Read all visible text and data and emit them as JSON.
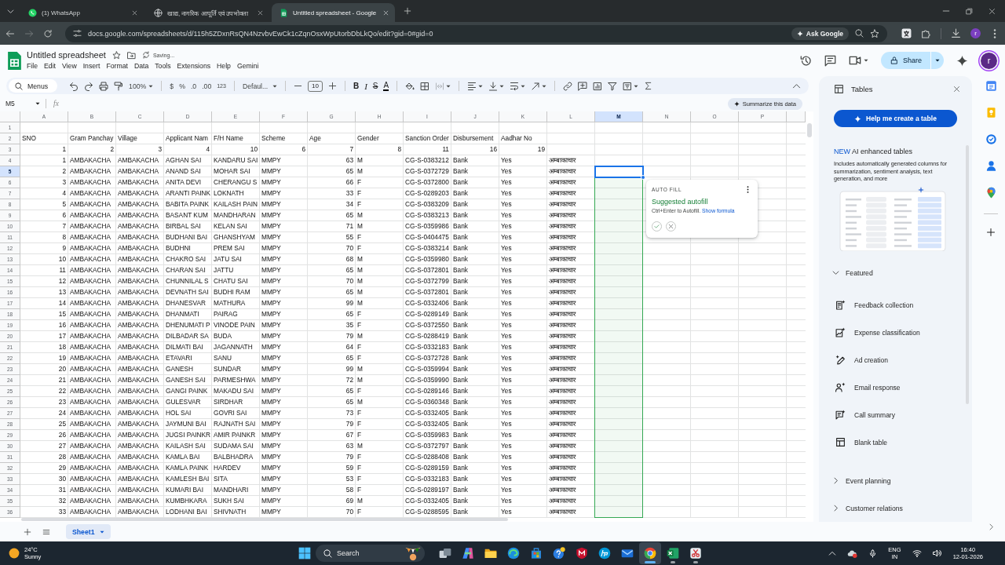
{
  "browser": {
    "tabs": [
      {
        "title": "(1) WhatsApp",
        "selected": false
      },
      {
        "title": "खाद्य, नागरिक आपूर्ति एवं उपभोक्ता",
        "selected": false
      },
      {
        "title": "Untitled spreadsheet - Google",
        "selected": true
      }
    ],
    "forward_button": {
      "disabled": true
    },
    "url": "docs.google.com/spreadsheets/d/115h5ZDxnRsQN4NzvbvEwCk1cZqnOsxWpUtorbDbLkQo/edit?gid=0#gid=0",
    "ask_button": "Ask Google",
    "profile_initial": "r"
  },
  "document": {
    "title": "Untitled spreadsheet",
    "save_status": "Saving...",
    "menu": [
      "File",
      "Edit",
      "View",
      "Insert",
      "Format",
      "Data",
      "Tools",
      "Extensions",
      "Help",
      "Gemini"
    ],
    "share_button": "Share",
    "account_initial": "r"
  },
  "toolbar": {
    "search": "Menus",
    "zoom": "100%",
    "currency": "$",
    "percent": "%",
    "decrease_decimal": ".0",
    "increase_decimal": ".00",
    "number_format": "123",
    "font": "Defaul...",
    "font_size": "10",
    "bold": "B",
    "italic": "I",
    "strikethrough": "S",
    "text_color": "A",
    "merge_button": {
      "disabled": true
    }
  },
  "formula_bar": {
    "cell_reference": "M5",
    "function_label": "fx"
  },
  "summarize_button": "Summarize this data",
  "sheet": {
    "columns": [
      {
        "label": "A",
        "selected": false
      },
      {
        "label": "B",
        "selected": false
      },
      {
        "label": "C",
        "selected": false
      },
      {
        "label": "D",
        "selected": false
      },
      {
        "label": "E",
        "selected": false
      },
      {
        "label": "F",
        "selected": false
      },
      {
        "label": "G",
        "selected": false
      },
      {
        "label": "H",
        "selected": false
      },
      {
        "label": "I",
        "selected": false
      },
      {
        "label": "J",
        "selected": false
      },
      {
        "label": "K",
        "selected": false
      },
      {
        "label": "L",
        "selected": false
      },
      {
        "label": "M",
        "selected": true
      },
      {
        "label": "N",
        "selected": false
      },
      {
        "label": "O",
        "selected": false
      },
      {
        "label": "P",
        "selected": false
      }
    ],
    "rows": [
      {
        "number": "1",
        "selected": false
      },
      {
        "number": "2",
        "selected": false,
        "cells": [
          "SNO",
          "Gram Panchay",
          "Village",
          "Applicant Nam",
          "F/H Name",
          "Scheme",
          "Age",
          "Gender",
          "Sanction Order",
          "Disbursement",
          "Aadhar No"
        ]
      },
      {
        "number": "3",
        "selected": false,
        "cells": [
          "1",
          "2",
          "3",
          "4",
          "10",
          "6",
          "7",
          "8",
          "11",
          "16",
          "19"
        ]
      },
      {
        "number": "4",
        "selected": false,
        "cells": [
          "1",
          "AMBAKACHA",
          "AMBAKACHA",
          "AGHAN SAI",
          "KANDARU SAI",
          "MMPY",
          "63",
          "M",
          "CG-S-0383212",
          "Bank",
          "Yes",
          "अम्बाकाचार"
        ]
      },
      {
        "number": "5",
        "selected": true,
        "cells": [
          "2",
          "AMBAKACHA",
          "AMBAKACHA",
          "ANAND SAI",
          "MOHAR SAI",
          "MMPY",
          "65",
          "M",
          "CG-S-0372729",
          "Bank",
          "Yes",
          "अम्बाकाचार"
        ]
      },
      {
        "number": "6",
        "selected": false,
        "cells": [
          "3",
          "AMBAKACHA",
          "AMBAKACHA",
          "ANITA DEVI",
          "CHERANGU S",
          "MMPY",
          "66",
          "F",
          "CG-S-0372800",
          "Bank",
          "Yes",
          "अम्बाकाचार"
        ]
      },
      {
        "number": "7",
        "selected": false,
        "cells": [
          "4",
          "AMBAKACHA",
          "AMBAKACHA",
          "ARANTI PAINK",
          "LOKNATH",
          "MMPY",
          "33",
          "F",
          "CG-S-0289203",
          "Bank",
          "Yes",
          "अम्बाकाचार"
        ]
      },
      {
        "number": "8",
        "selected": false,
        "cells": [
          "5",
          "AMBAKACHA",
          "AMBAKACHA",
          "BABITA PAINK",
          "KAILASH PAIN",
          "MMPY",
          "34",
          "F",
          "CG-S-0383209",
          "Bank",
          "Yes",
          "अम्बाकाचार"
        ]
      },
      {
        "number": "9",
        "selected": false,
        "cells": [
          "6",
          "AMBAKACHA",
          "AMBAKACHA",
          "BASANT KUM",
          "MANDHARAN",
          "MMPY",
          "65",
          "M",
          "CG-S-0383213",
          "Bank",
          "Yes",
          "अम्बाकाचार"
        ]
      },
      {
        "number": "10",
        "selected": false,
        "cells": [
          "7",
          "AMBAKACHA",
          "AMBAKACHA",
          "BIRBAL SAI",
          "KELAN SAI",
          "MMPY",
          "71",
          "M",
          "CG-S-0359986",
          "Bank",
          "Yes",
          "अम्बाकाचार"
        ]
      },
      {
        "number": "11",
        "selected": false,
        "cells": [
          "8",
          "AMBAKACHA",
          "AMBAKACHA",
          "BUDHANI BAI",
          "GHANSHYAM",
          "MMPY",
          "55",
          "F",
          "CG-S-0404475",
          "Bank",
          "Yes",
          "अम्बाकाचार"
        ]
      },
      {
        "number": "12",
        "selected": false,
        "cells": [
          "9",
          "AMBAKACHA",
          "AMBAKACHA",
          "BUDHNI",
          "PREM SAI",
          "MMPY",
          "70",
          "F",
          "CG-S-0383214",
          "Bank",
          "Yes",
          "अम्बाकाचार"
        ]
      },
      {
        "number": "13",
        "selected": false,
        "cells": [
          "10",
          "AMBAKACHA",
          "AMBAKACHA",
          "CHAKRO SAI",
          "JATU SAI",
          "MMPY",
          "68",
          "M",
          "CG-S-0359980",
          "Bank",
          "Yes",
          "अम्बाकाचार"
        ]
      },
      {
        "number": "14",
        "selected": false,
        "cells": [
          "11",
          "AMBAKACHA",
          "AMBAKACHA",
          "CHARAN SAI",
          "JATTU",
          "MMPY",
          "65",
          "M",
          "CG-S-0372801",
          "Bank",
          "Yes",
          "अम्बाकाचार"
        ]
      },
      {
        "number": "15",
        "selected": false,
        "cells": [
          "12",
          "AMBAKACHA",
          "AMBAKACHA",
          "CHUNNILAL S",
          "CHATU SAI",
          "MMPY",
          "70",
          "M",
          "CG-S-0372799",
          "Bank",
          "Yes",
          "अम्बाकाचार"
        ]
      },
      {
        "number": "16",
        "selected": false,
        "cells": [
          "13",
          "AMBAKACHA",
          "AMBAKACHA",
          "DEVNATH SAI",
          "BUDHI RAM",
          "MMPY",
          "65",
          "M",
          "CG-S-0372801",
          "Bank",
          "Yes",
          "अम्बाकाचार"
        ]
      },
      {
        "number": "17",
        "selected": false,
        "cells": [
          "14",
          "AMBAKACHA",
          "AMBAKACHA",
          "DHANESVAR",
          "MATHURA",
          "MMPY",
          "99",
          "M",
          "CG-S-0332406",
          "Bank",
          "Yes",
          "अम्बाकाचार"
        ]
      },
      {
        "number": "18",
        "selected": false,
        "cells": [
          "15",
          "AMBAKACHA",
          "AMBAKACHA",
          "DHANMATI",
          "PAIRAG",
          "MMPY",
          "65",
          "F",
          "CG-S-0289149",
          "Bank",
          "Yes",
          "अम्बाकाचार"
        ]
      },
      {
        "number": "19",
        "selected": false,
        "cells": [
          "16",
          "AMBAKACHA",
          "AMBAKACHA",
          "DHENUMATI P",
          "VINODE PAIN",
          "MMPY",
          "35",
          "F",
          "CG-S-0372550",
          "Bank",
          "Yes",
          "अम्बाकाचार"
        ]
      },
      {
        "number": "20",
        "selected": false,
        "cells": [
          "17",
          "AMBAKACHA",
          "AMBAKACHA",
          "DILBADAR SA",
          "BUDA",
          "MMPY",
          "79",
          "M",
          "CG-S-0288419",
          "Bank",
          "Yes",
          "अम्बाकाचार"
        ]
      },
      {
        "number": "21",
        "selected": false,
        "cells": [
          "18",
          "AMBAKACHA",
          "AMBAKACHA",
          "DILMATI BAI",
          "JAGANNATH",
          "MMPY",
          "64",
          "F",
          "CG-S-0332183",
          "Bank",
          "Yes",
          "अम्बाकाचार"
        ]
      },
      {
        "number": "22",
        "selected": false,
        "cells": [
          "19",
          "AMBAKACHA",
          "AMBAKACHA",
          "ETAVARI",
          "SANU",
          "MMPY",
          "65",
          "F",
          "CG-S-0372728",
          "Bank",
          "Yes",
          "अम्बाकाचार"
        ]
      },
      {
        "number": "23",
        "selected": false,
        "cells": [
          "20",
          "AMBAKACHA",
          "AMBAKACHA",
          "GANESH",
          "SUNDAR",
          "MMPY",
          "99",
          "M",
          "CG-S-0359994",
          "Bank",
          "Yes",
          "अम्बाकाचार"
        ]
      },
      {
        "number": "24",
        "selected": false,
        "cells": [
          "21",
          "AMBAKACHA",
          "AMBAKACHA",
          "GANESH SAI",
          "PARMESHWA",
          "MMPY",
          "72",
          "M",
          "CG-S-0359990",
          "Bank",
          "Yes",
          "अम्बाकाचार"
        ]
      },
      {
        "number": "25",
        "selected": false,
        "cells": [
          "22",
          "AMBAKACHA",
          "AMBAKACHA",
          "GANGI PAINK",
          "MAKADU SAI",
          "MMPY",
          "65",
          "F",
          "CG-S-0289146",
          "Bank",
          "Yes",
          "अम्बाकाचार"
        ]
      },
      {
        "number": "26",
        "selected": false,
        "cells": [
          "23",
          "AMBAKACHA",
          "AMBAKACHA",
          "GULESVAR",
          "SIRDHAR",
          "MMPY",
          "65",
          "M",
          "CG-S-0360348",
          "Bank",
          "Yes",
          "अम्बाकाचार"
        ]
      },
      {
        "number": "27",
        "selected": false,
        "cells": [
          "24",
          "AMBAKACHA",
          "AMBAKACHA",
          "HOL SAI",
          "GOVRI SAI",
          "MMPY",
          "73",
          "F",
          "CG-S-0332405",
          "Bank",
          "Yes",
          "अम्बाकाचार"
        ]
      },
      {
        "number": "28",
        "selected": false,
        "cells": [
          "25",
          "AMBAKACHA",
          "AMBAKACHA",
          "JAYMUNI BAI",
          "RAJNATH SAI",
          "MMPY",
          "79",
          "F",
          "CG-S-0332405",
          "Bank",
          "Yes",
          "अम्बाकाचार"
        ]
      },
      {
        "number": "29",
        "selected": false,
        "cells": [
          "26",
          "AMBAKACHA",
          "AMBAKACHA",
          "JUGSI PAINKR",
          "AMIR PAINKR",
          "MMPY",
          "67",
          "F",
          "CG-S-0359983",
          "Bank",
          "Yes",
          "अम्बाकाचार"
        ]
      },
      {
        "number": "30",
        "selected": false,
        "cells": [
          "27",
          "AMBAKACHA",
          "AMBAKACHA",
          "KAILASH SAI",
          "SUDAMA SAI",
          "MMPY",
          "63",
          "M",
          "CG-S-0372797",
          "Bank",
          "Yes",
          "अम्बाकाचार"
        ]
      },
      {
        "number": "31",
        "selected": false,
        "cells": [
          "28",
          "AMBAKACHA",
          "AMBAKACHA",
          "KAMLA BAI",
          "BALBHADRA",
          "MMPY",
          "79",
          "F",
          "CG-S-0288408",
          "Bank",
          "Yes",
          "अम्बाकाचार"
        ]
      },
      {
        "number": "32",
        "selected": false,
        "cells": [
          "29",
          "AMBAKACHA",
          "AMBAKACHA",
          "KAMLA PAINK",
          "HARDEV",
          "MMPY",
          "59",
          "F",
          "CG-S-0289159",
          "Bank",
          "Yes",
          "अम्बाकाचार"
        ]
      },
      {
        "number": "33",
        "selected": false,
        "cells": [
          "30",
          "AMBAKACHA",
          "AMBAKACHA",
          "KAMLESH BAI",
          "SITA",
          "MMPY",
          "53",
          "F",
          "CG-S-0332183",
          "Bank",
          "Yes",
          "अम्बाकाचार"
        ]
      },
      {
        "number": "34",
        "selected": false,
        "cells": [
          "31",
          "AMBAKACHA",
          "AMBAKACHA",
          "KUMARI BAI",
          "MANDHARI",
          "MMPY",
          "58",
          "F",
          "CG-S-0289197",
          "Bank",
          "Yes",
          "अम्बाकाचार"
        ]
      },
      {
        "number": "35",
        "selected": false,
        "cells": [
          "32",
          "AMBAKACHA",
          "AMBAKACHA",
          "KUMBHKARA",
          "SUKH SAI",
          "MMPY",
          "69",
          "M",
          "CG-S-0332405",
          "Bank",
          "Yes",
          "अम्बाकाचार"
        ]
      },
      {
        "number": "36",
        "selected": false,
        "cells": [
          "33",
          "AMBAKACHA",
          "AMBAKACHA",
          "LODHANI BAI",
          "SHIVNATH",
          "MMPY",
          "70",
          "F",
          "CG-S-0288595",
          "Bank",
          "Yes",
          "अम्बाकाचार"
        ]
      }
    ]
  },
  "autofill": {
    "label": "AUTO FILL",
    "title": "Suggested autofill",
    "hint": "Ctrl+Enter to Autofill.",
    "link": "Show formula"
  },
  "sheet_tabs": [
    {
      "label": "Sheet1",
      "selected": true
    }
  ],
  "side_panel": {
    "title": "Tables",
    "create_button": "Help me create a table",
    "promo": {
      "badge": "NEW",
      "title": "AI enhanced tables",
      "description": "Includes automatically generated columns for summarization, sentiment analysis, text generation, and more"
    },
    "sections": [
      {
        "label": "Featured",
        "expanded": true,
        "items": [
          "Feedback collection",
          "Expense classification",
          "Ad creation",
          "Email response",
          "Call summary",
          "Blank table"
        ]
      },
      {
        "label": "Event planning",
        "expanded": false
      },
      {
        "label": "Customer relations",
        "expanded": false
      }
    ]
  },
  "taskbar": {
    "weather": {
      "temperature": "24°C",
      "condition": "Sunny"
    },
    "search": {
      "placeholder": "Search"
    },
    "apps": [
      {
        "running": false,
        "active": false
      },
      {
        "running": false,
        "active": false
      },
      {
        "running": false,
        "active": false
      },
      {
        "running": false,
        "active": false
      },
      {
        "running": false,
        "active": false
      },
      {
        "running": false,
        "active": false
      },
      {
        "running": false,
        "active": false
      },
      {
        "running": false,
        "active": false
      },
      {
        "running": false,
        "active": false
      },
      {
        "running": true,
        "active": true
      },
      {
        "running": true,
        "active": false
      },
      {
        "running": true,
        "active": false
      }
    ],
    "tray": {
      "language": "ENG",
      "region": "IN",
      "time": "16:40",
      "date": "12-01-2026"
    }
  }
}
